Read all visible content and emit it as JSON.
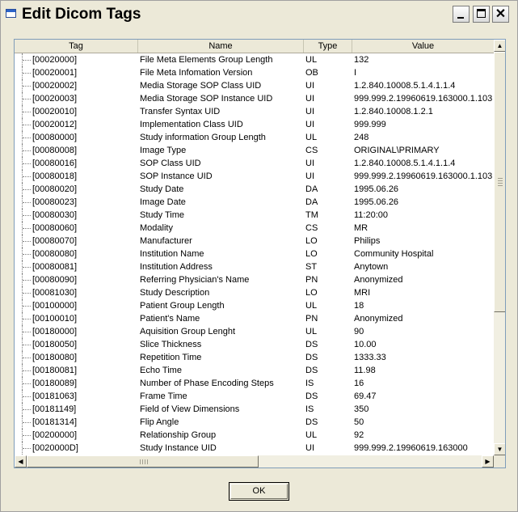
{
  "window": {
    "title": "Edit Dicom Tags"
  },
  "columns": {
    "tag": "Tag",
    "name": "Name",
    "type": "Type",
    "value": "Value"
  },
  "rows": [
    {
      "tag": "[00020000]",
      "name": "File Meta Elements Group Length",
      "type": "UL",
      "value": "132"
    },
    {
      "tag": "[00020001]",
      "name": "File Meta Infomation Version",
      "type": "OB",
      "value": "I"
    },
    {
      "tag": "[00020002]",
      "name": "Media Storage SOP Class UID",
      "type": "UI",
      "value": "1.2.840.10008.5.1.4.1.1.4"
    },
    {
      "tag": "[00020003]",
      "name": "Media Storage SOP Instance UID",
      "type": "UI",
      "value": "999.999.2.19960619.163000.1.103"
    },
    {
      "tag": "[00020010]",
      "name": "Transfer Syntax UID",
      "type": "UI",
      "value": "1.2.840.10008.1.2.1"
    },
    {
      "tag": "[00020012]",
      "name": "Implementation Class UID",
      "type": "UI",
      "value": "999.999"
    },
    {
      "tag": "[00080000]",
      "name": "Study information Group Length",
      "type": "UL",
      "value": "248"
    },
    {
      "tag": "[00080008]",
      "name": "Image Type",
      "type": "CS",
      "value": "ORIGINAL\\PRIMARY"
    },
    {
      "tag": "[00080016]",
      "name": "SOP Class UID",
      "type": "UI",
      "value": "1.2.840.10008.5.1.4.1.1.4"
    },
    {
      "tag": "[00080018]",
      "name": "SOP Instance UID",
      "type": "UI",
      "value": "999.999.2.19960619.163000.1.103"
    },
    {
      "tag": "[00080020]",
      "name": "Study Date",
      "type": "DA",
      "value": "1995.06.26"
    },
    {
      "tag": "[00080023]",
      "name": "Image Date",
      "type": "DA",
      "value": "1995.06.26"
    },
    {
      "tag": "[00080030]",
      "name": "Study Time",
      "type": "TM",
      "value": "11:20:00"
    },
    {
      "tag": "[00080060]",
      "name": "Modality",
      "type": "CS",
      "value": "MR"
    },
    {
      "tag": "[00080070]",
      "name": "Manufacturer",
      "type": "LO",
      "value": "Philips"
    },
    {
      "tag": "[00080080]",
      "name": "Institution Name",
      "type": "LO",
      "value": "Community Hospital"
    },
    {
      "tag": "[00080081]",
      "name": "Institution Address",
      "type": "ST",
      "value": "Anytown"
    },
    {
      "tag": "[00080090]",
      "name": "Referring Physician's Name",
      "type": "PN",
      "value": "Anonymized"
    },
    {
      "tag": "[00081030]",
      "name": "Study Description",
      "type": "LO",
      "value": "MRI"
    },
    {
      "tag": "[00100000]",
      "name": "Patient Group Length",
      "type": "UL",
      "value": "18"
    },
    {
      "tag": "[00100010]",
      "name": "Patient's Name",
      "type": "PN",
      "value": "Anonymized"
    },
    {
      "tag": "[00180000]",
      "name": "Aquisition Group Lenght",
      "type": "UL",
      "value": "90"
    },
    {
      "tag": "[00180050]",
      "name": "Slice Thickness",
      "type": "DS",
      "value": "10.00"
    },
    {
      "tag": "[00180080]",
      "name": "Repetition Time",
      "type": "DS",
      "value": "1333.33"
    },
    {
      "tag": "[00180081]",
      "name": "Echo Time",
      "type": "DS",
      "value": "11.98"
    },
    {
      "tag": "[00180089]",
      "name": "Number of Phase Encoding Steps",
      "type": "IS",
      "value": "16"
    },
    {
      "tag": "[00181063]",
      "name": "Frame Time",
      "type": "DS",
      "value": "69.47"
    },
    {
      "tag": "[00181149]",
      "name": "Field of View Dimensions",
      "type": "IS",
      "value": "350"
    },
    {
      "tag": "[00181314]",
      "name": "Flip Angle",
      "type": "DS",
      "value": "50"
    },
    {
      "tag": "[00200000]",
      "name": "Relationship Group",
      "type": "UL",
      "value": "92"
    },
    {
      "tag": "[0020000D]",
      "name": "Study Instance UID",
      "type": "UI",
      "value": "999.999.2.19960619.163000"
    }
  ],
  "footer": {
    "ok_label": "OK"
  },
  "icons": {
    "app": "window-icon",
    "minimize": "minimize-icon",
    "maximize": "maximize-icon",
    "close": "close-icon"
  }
}
